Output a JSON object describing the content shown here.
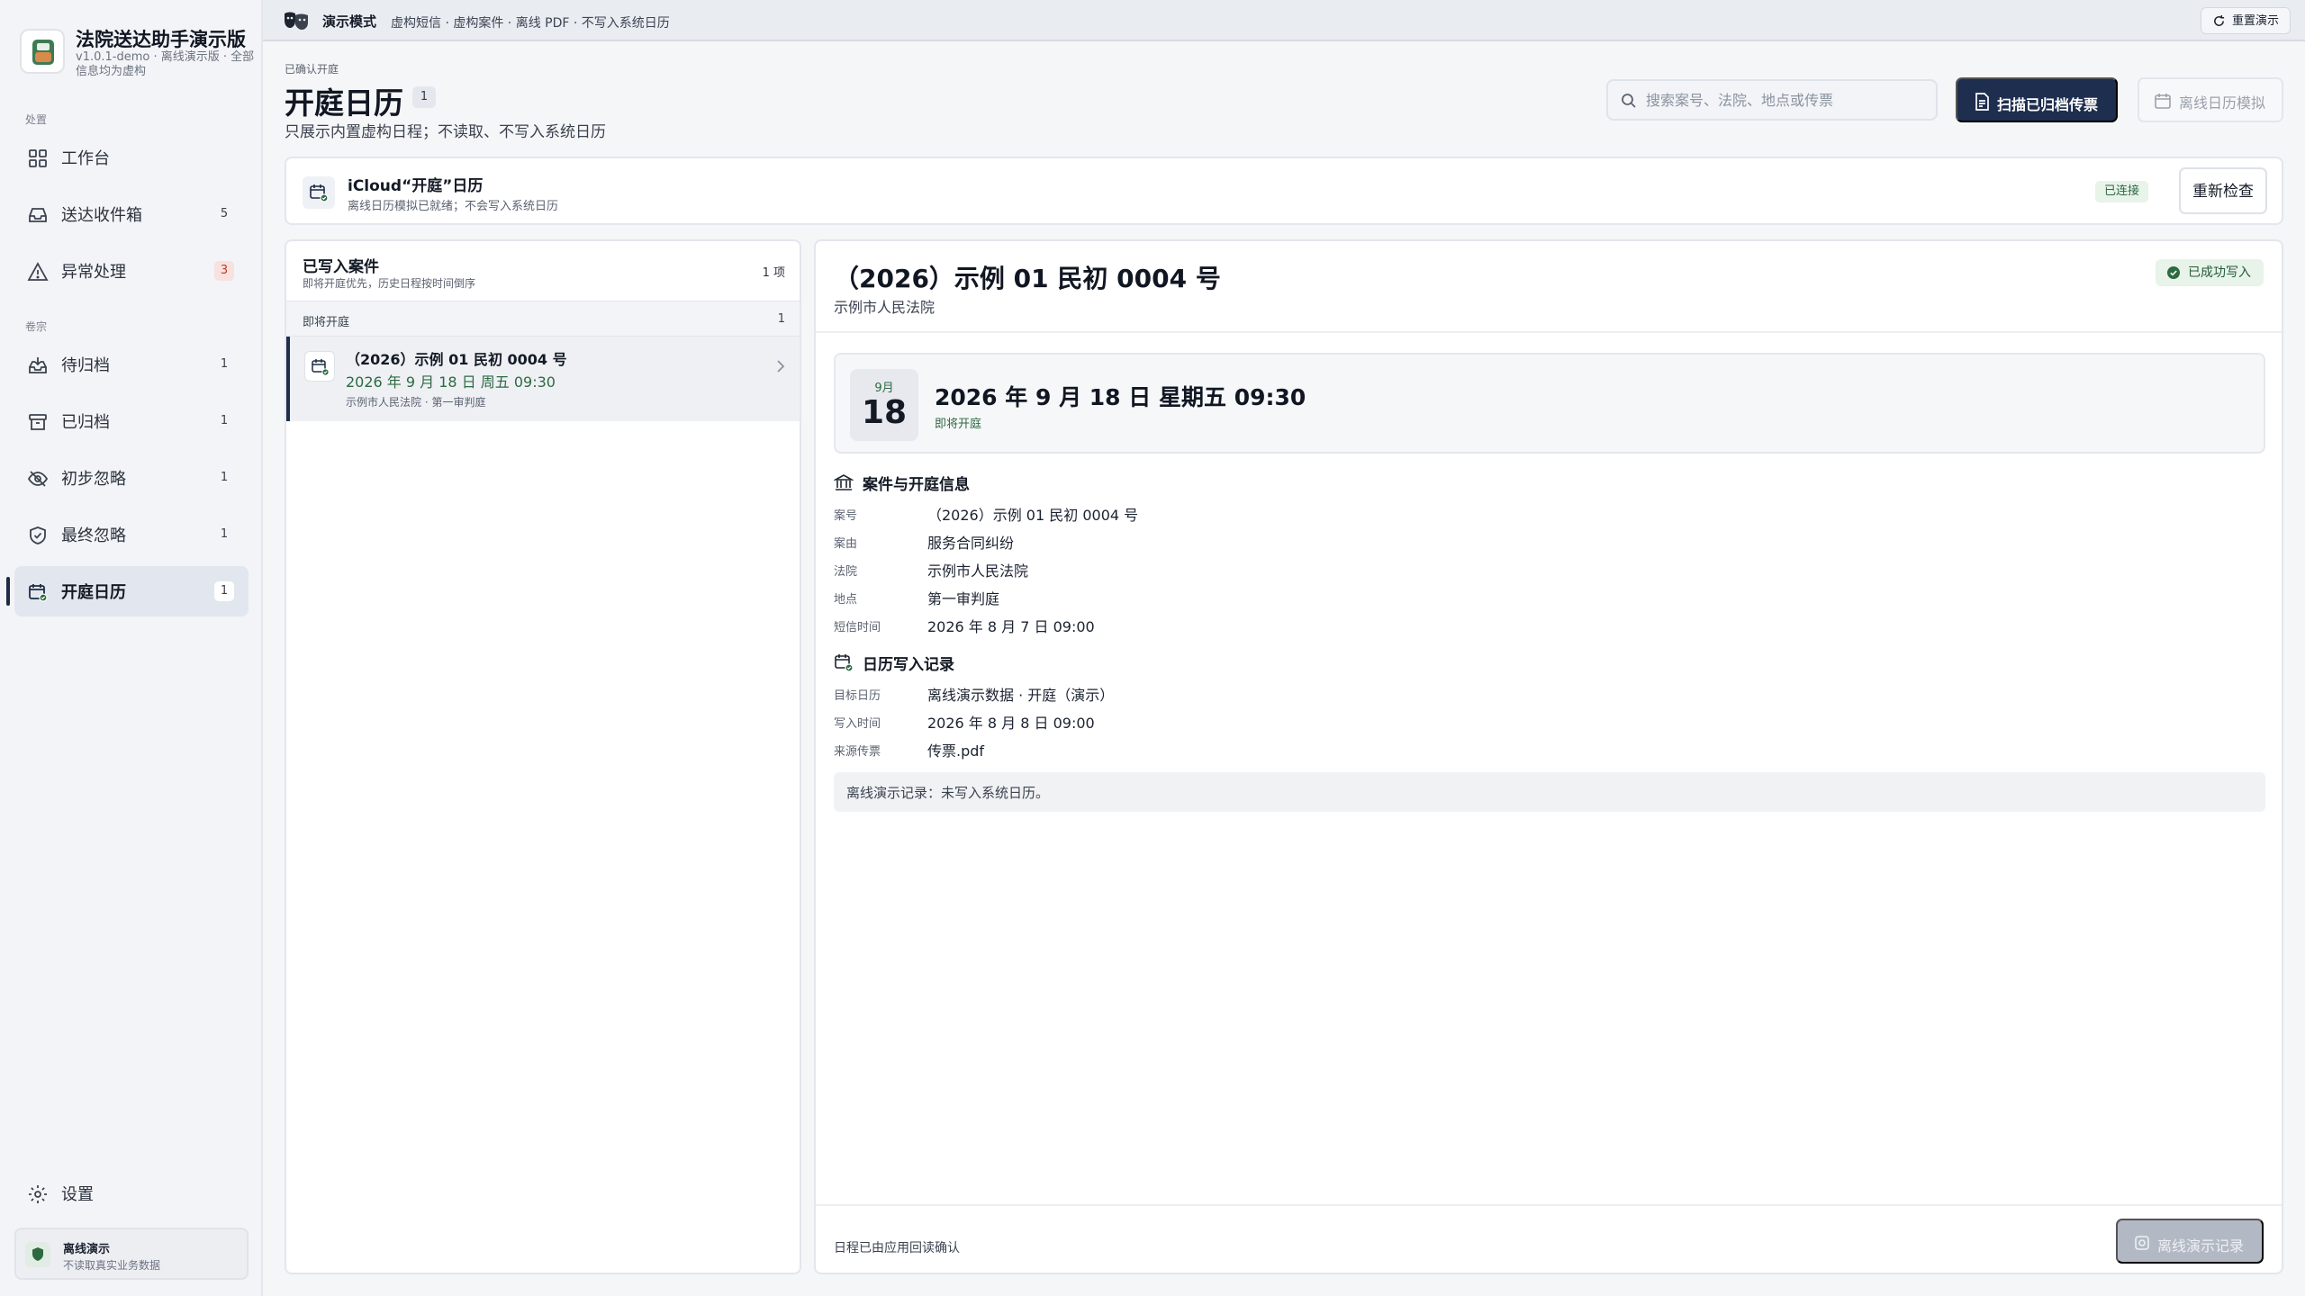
{
  "app": {
    "title": "法院送达助手演示版",
    "subtitle": "v1.0.1-demo · 离线演示版 · 全部信息均为虚构"
  },
  "sidebar": {
    "section_1": "处置",
    "section_2": "卷宗",
    "items": [
      {
        "label": "工作台",
        "badge": "",
        "icon": "grid-icon"
      },
      {
        "label": "送达收件箱",
        "badge": "5",
        "icon": "inbox-icon"
      },
      {
        "label": "异常处理",
        "badge": "3",
        "icon": "warning-icon"
      },
      {
        "label": "待归档",
        "badge": "1",
        "icon": "inbox-down-icon"
      },
      {
        "label": "已归档",
        "badge": "1",
        "icon": "archive-icon"
      },
      {
        "label": "初步忽略",
        "badge": "1",
        "icon": "eye-off-icon"
      },
      {
        "label": "最终忽略",
        "badge": "1",
        "icon": "shield-check-icon"
      },
      {
        "label": "开庭日历",
        "badge": "1",
        "icon": "calendar-check-icon"
      }
    ],
    "settings_label": "设置",
    "offline": {
      "title": "离线演示",
      "subtitle": "不读取真实业务数据"
    }
  },
  "topbar": {
    "mode": "演示模式",
    "description": "虚构短信 · 虚构案件 · 离线 PDF · 不写入系统日历",
    "reset_label": "重置演示"
  },
  "header": {
    "breadcrumb": "已确认开庭",
    "title": "开庭日历",
    "count": "1",
    "subtitle": "只展示内置虚构日程；不读取、不写入系统日历",
    "search_placeholder": "搜索案号、法院、地点或传票",
    "scan_button": "扫描已归档传票",
    "offline_calendar_button": "离线日历模拟"
  },
  "calendar_status": {
    "title": "iCloud“开庭”日历",
    "subtitle": "离线日历模拟已就绪；不会写入系统日历",
    "badge": "已连接",
    "recheck_button": "重新检查"
  },
  "case_list": {
    "title": "已写入案件",
    "subtitle": "即将开庭优先，历史日程按时间倒序",
    "count": "1 项",
    "group_label": "即将开庭",
    "group_count": "1",
    "items": [
      {
        "title": "（2026）示例 01 民初 0004 号",
        "time": "2026 年 9 月 18 日 周五 09:30",
        "meta": "示例市人民法院 · 第一审判庭"
      }
    ]
  },
  "detail": {
    "title": "（2026）示例 01 民初 0004 号",
    "court": "示例市人民法院",
    "status_badge": "已成功写入",
    "date_month": "9月",
    "date_day": "18",
    "date_full": "2026 年 9 月 18 日 星期五 09:30",
    "date_status": "即将开庭",
    "case_section_title": "案件与开庭信息",
    "case_fields": [
      {
        "label": "案号",
        "value": "（2026）示例 01 民初 0004 号"
      },
      {
        "label": "案由",
        "value": "服务合同纠纷"
      },
      {
        "label": "法院",
        "value": "示例市人民法院"
      },
      {
        "label": "地点",
        "value": "第一审判庭"
      },
      {
        "label": "短信时间",
        "value": "2026 年 8 月 7 日 09:00"
      }
    ],
    "record_section_title": "日历写入记录",
    "record_fields": [
      {
        "label": "目标日历",
        "value": "离线演示数据 · 开庭（演示）"
      },
      {
        "label": "写入时间",
        "value": "2026 年 8 月 8 日 09:00"
      },
      {
        "label": "来源传票",
        "value": "传票.pdf"
      }
    ],
    "note": "离线演示记录：未写入系统日历。",
    "footer_text": "日程已由应用回读确认",
    "footer_button": "离线演示记录"
  }
}
